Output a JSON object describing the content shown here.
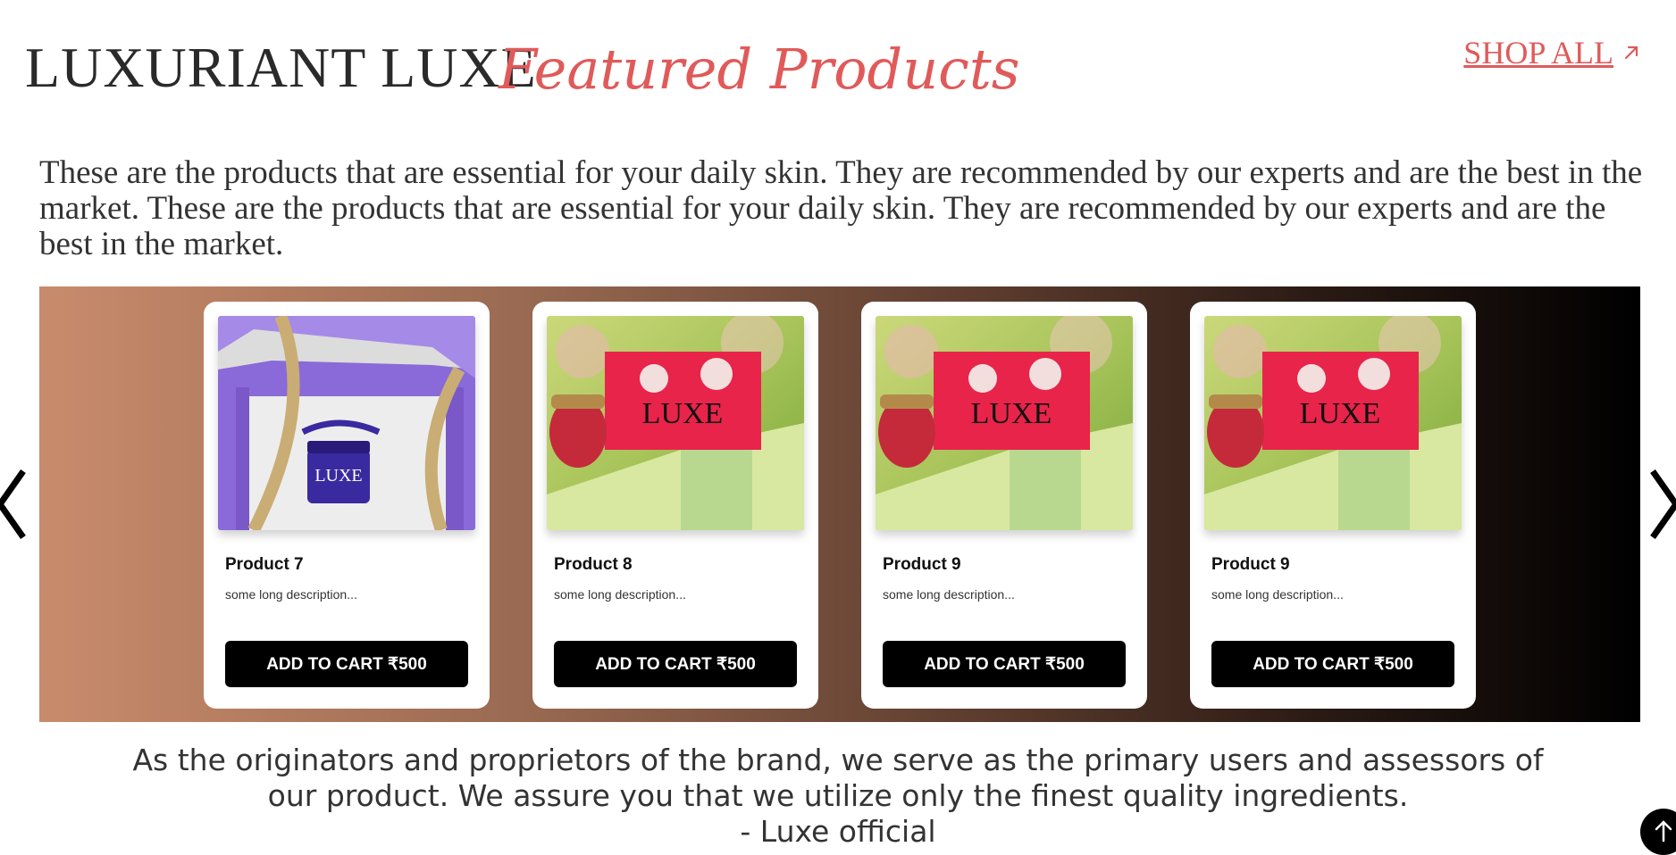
{
  "header": {
    "brand": "LUXURIANT LUXE",
    "section_title": "Featured Products",
    "shop_all_label": "SHOP ALL",
    "shop_all_icon": "arrow-up-right-icon"
  },
  "intro": {
    "text": "These are the products that are essential for your daily skin. They are recommended by our experts and are the best in the market. These are the products that are essential for your daily skin. They are recommended by our experts and are the best in the market."
  },
  "colors": {
    "accent": "#e05a5a",
    "button_bg": "#000000",
    "carousel_start": "#c98b6c",
    "carousel_end": "#000000"
  },
  "carousel": {
    "prev_icon": "chevron-left-icon",
    "next_icon": "chevron-right-icon",
    "products": [
      {
        "name": "Product 7",
        "description": "some long description...",
        "button": "ADD TO CART ₹500",
        "image": "purple-gift-box-jar"
      },
      {
        "name": "Product 8",
        "description": "some long description...",
        "button": "ADD TO CART ₹500",
        "image": "pink-box-jar"
      },
      {
        "name": "Product 9",
        "description": "some long description...",
        "button": "ADD TO CART ₹500",
        "image": "pink-box-jar"
      },
      {
        "name": "Product 9",
        "description": "some long description...",
        "button": "ADD TO CART ₹500",
        "image": "pink-box-jar"
      }
    ]
  },
  "quote": {
    "line1": "As the originators and proprietors of the brand, we serve as the primary users and assessors of",
    "line2": "our product. We assure you that we utilize only the finest quality ingredients.",
    "signature": "- Luxe official"
  },
  "scroll_top": {
    "icon": "arrow-up-icon"
  }
}
